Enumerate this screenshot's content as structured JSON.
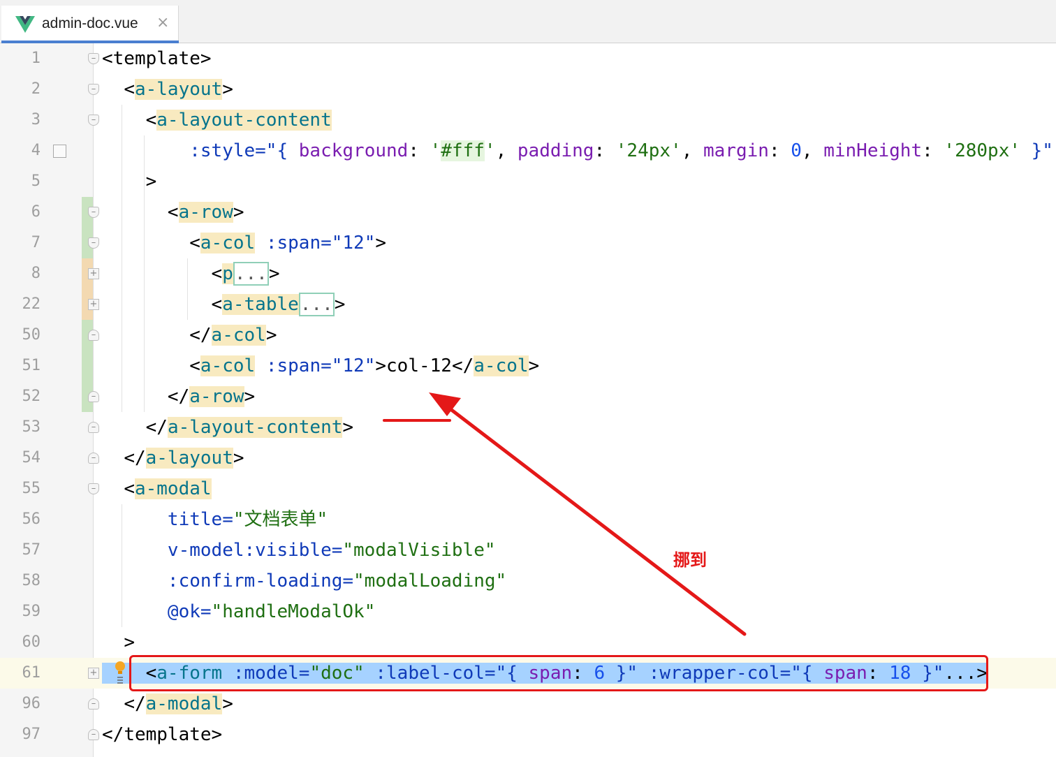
{
  "tab": {
    "filename": "admin-doc.vue",
    "close_glyph": "×",
    "icon": "vue-logo-icon"
  },
  "annotation": {
    "text": "挪到",
    "color": "#e41818"
  },
  "lines": [
    {
      "num": "1"
    },
    {
      "num": "2"
    },
    {
      "num": "3"
    },
    {
      "num": "4"
    },
    {
      "num": "5"
    },
    {
      "num": "6"
    },
    {
      "num": "7"
    },
    {
      "num": "8"
    },
    {
      "num": "22"
    },
    {
      "num": "50"
    },
    {
      "num": "51"
    },
    {
      "num": "52"
    },
    {
      "num": "53"
    },
    {
      "num": "54"
    },
    {
      "num": "55"
    },
    {
      "num": "56"
    },
    {
      "num": "57"
    },
    {
      "num": "58"
    },
    {
      "num": "59"
    },
    {
      "num": "60"
    },
    {
      "num": "61"
    },
    {
      "num": "96"
    },
    {
      "num": "97"
    }
  ],
  "code": {
    "l1": [
      "<",
      "template",
      ">"
    ],
    "l2": [
      "<",
      "a-layout",
      ">"
    ],
    "l3": [
      "<",
      "a-layout-content"
    ],
    "l4": [
      ":style=\"{ ",
      "background",
      ": ",
      "'",
      "#fff",
      "'",
      ", ",
      "padding",
      ": ",
      "'24px'",
      ", ",
      "margin",
      ": ",
      "0",
      ", ",
      "minHeight",
      ": ",
      "'280px'",
      " }\""
    ],
    "l5": [
      ">"
    ],
    "l6": [
      "<",
      "a-row",
      ">"
    ],
    "l7": [
      "<",
      "a-col",
      " :span=",
      "\"12\"",
      ">"
    ],
    "l8": [
      "<",
      "p",
      "...",
      ">"
    ],
    "l22": [
      "<",
      "a-table",
      "...",
      ">"
    ],
    "l50": [
      "</",
      "a-col",
      ">"
    ],
    "l51": [
      "<",
      "a-col",
      " :span=",
      "\"12\"",
      ">",
      "col-12",
      "</",
      "a-col",
      ">"
    ],
    "l52": [
      "</",
      "a-row",
      ">"
    ],
    "l53": [
      "</",
      "a-layout-content",
      ">"
    ],
    "l54": [
      "</",
      "a-layout",
      ">"
    ],
    "l55": [
      "<",
      "a-modal"
    ],
    "l56": [
      "title=",
      "\"文档表单\""
    ],
    "l57": [
      "v-model:visible=",
      "\"modalVisible\""
    ],
    "l58": [
      ":confirm-loading=",
      "\"modalLoading\""
    ],
    "l59": [
      "@ok=",
      "\"handleModalOk\""
    ],
    "l60": [
      ">"
    ],
    "l61": [
      "<",
      "a-form",
      " :model=",
      "\"doc\"",
      " :label-col=",
      "\"{ ",
      "span",
      ": ",
      "6",
      " }\"",
      " :wrapper-col=",
      "\"{ ",
      "span",
      ": ",
      "18",
      " }\"",
      "...",
      ">"
    ],
    "l96": [
      "</",
      "a-modal",
      ">"
    ],
    "l97": [
      "</",
      "template",
      ">"
    ]
  }
}
